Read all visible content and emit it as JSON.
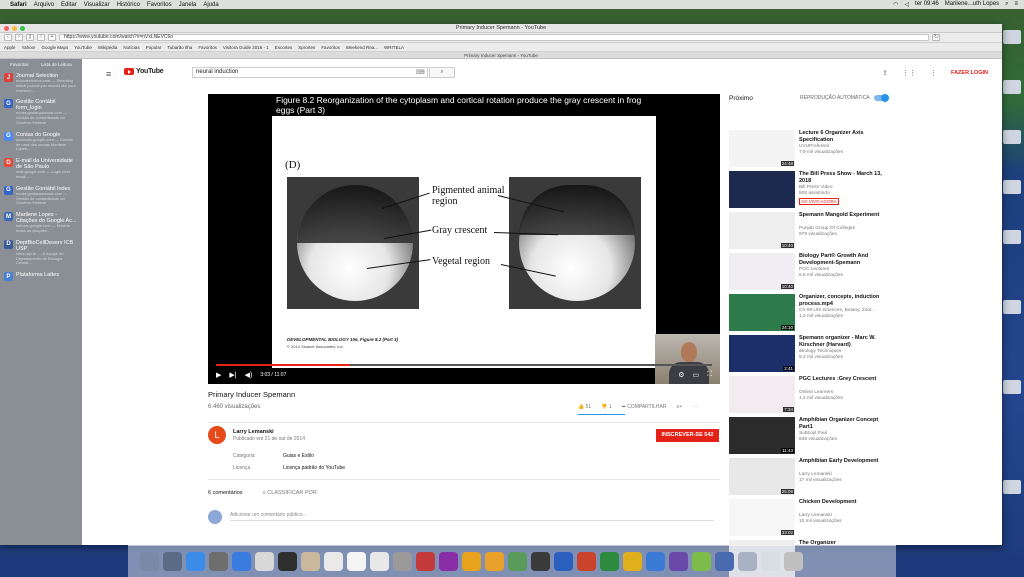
{
  "menubar": {
    "apple": "",
    "items": [
      "Safari",
      "Arquivo",
      "Editar",
      "Visualizar",
      "Histórico",
      "Favoritos",
      "Janela",
      "Ajuda"
    ],
    "clock": "ter 09:46",
    "user": "Marilene...uth Lopes"
  },
  "browser": {
    "window_title": "Primary Inducer Spemann - YouTube",
    "url": "https://www.youtube.com/watch?v=nVxLNEVC6o",
    "bookmarks": [
      "Apple",
      "Yahoo!",
      "Google Maps",
      "YouTube",
      "Wikipédia",
      "Notícias",
      "Popular",
      "Tubarão Ilha",
      "Favoritos",
      "Visitora Guide 2016 - 1",
      "Escortes",
      "Sprortes",
      "Favoritos",
      "Weekend Rea...",
      "WRITELA"
    ],
    "tab_title": "Primary Inducer Spemann - YouTube"
  },
  "sidebar": {
    "tab_bookmarks": "Favoritos",
    "tab_reading": "Lista de Leitura",
    "items": [
      {
        "title": "Journal Selection",
        "desc": "ecbiotechinfos.com — Selecting which journal you should like your research...",
        "color": "#d8423a",
        "glyph": "J"
      },
      {
        "title": "Gestão Contábil form_login",
        "desc": "ecoss.gestaopessoal.com — Gestão de contabilidade do Governo Federal",
        "color": "#3465c4",
        "glyph": "G"
      },
      {
        "title": "Contas do Google",
        "desc": "accounts.google.com — Contas de uma das contas Marilene Lopes...",
        "color": "#4a8af4",
        "glyph": "G"
      },
      {
        "title": "E-mail da Universidade de São Paulo",
        "desc": "mail.google.com — Login pelo email...",
        "color": "#e24a3a",
        "glyph": "G"
      },
      {
        "title": "Gestão Contábil Index",
        "desc": "ecoss.gestaopessoal.com — Gestão de contabilidade do Governo Federal",
        "color": "#3465c4",
        "glyph": "G"
      },
      {
        "title": "Marilene Lopes - Citações do Google Ac...",
        "desc": "scholar.google.com — Mostrar todas as citações...",
        "color": "#3c69b5",
        "glyph": "M"
      },
      {
        "title": "DeptBioCellDeserv ICB USP",
        "desc": "sites.usp.br — A equipe do Departamento de Biologia Celular...",
        "color": "#3b5b98",
        "glyph": "D"
      },
      {
        "title": "Plataforma Lattes",
        "desc": "",
        "color": "#4a7fd3",
        "glyph": "P"
      }
    ]
  },
  "youtube": {
    "logo_text": "YouTube",
    "search_value": "neural induction",
    "login": "FAZER LOGIN",
    "video": {
      "caption": "Figure 8.2  Reorganization of the cytoplasm and cortical rotation produce the gray crescent in frog eggs (Part 3)",
      "panel_label": "(D)",
      "labels": [
        "Pigmented animal region",
        "Gray crescent",
        "Vegetal region"
      ],
      "source": "DEVELOPMENTAL BIOLOGY 10e, Figure 8.2 (Part 3)",
      "copyright": "© 2014 Sinauer Associates, Inc.",
      "time": "3:03 / 11:07",
      "progress": 0.27
    },
    "title": "Primary Inducer Spemann",
    "views": "6.460 visualizações",
    "likes": "51",
    "dislikes": "1",
    "share": "COMPARTILHAR",
    "channel": "Larry Lemanski",
    "published": "Publicado em 21 de out de 2014",
    "subscribe": "INSCREVER-SE",
    "subscribers": "542",
    "category_label": "Categoria",
    "category": "Guias e Estilo",
    "license_label": "Licença",
    "license": "Licença padrão do YouTube",
    "comments_count": "6 comentários",
    "sort": "CLASSIFICAR POR",
    "comment_placeholder": "Adicionar um comentário público...",
    "upnext": "Próximo",
    "autoplay": "REPRODUÇÃO AUTOMÁTICA",
    "recommendations": [
      {
        "title": "Lecture 6 Organizer Axis Specification",
        "channel": "UVUProfessor",
        "views": "7,9 mil visualizações",
        "duration": "24:48",
        "thumb": "#f4f4f4",
        "live": ""
      },
      {
        "title": "The Bill Press Show - March 13, 2018",
        "channel": "Bill Press Video",
        "views": "508 assistindo",
        "duration": "",
        "thumb": "#1b2a4e",
        "live": "AO VIVO AGORA"
      },
      {
        "title": "Spemann Mangold Experiment",
        "channel": "Punjab Group Of Colleges",
        "views": "979 visualizações",
        "duration": "10:40",
        "thumb": "#eeeeee",
        "live": ""
      },
      {
        "title": "Biology Part® Growth And Development-Spemann",
        "channel": "PGC Lectures",
        "views": "6,6 mil visualizações",
        "duration": "10:40",
        "thumb": "#f0eef2",
        "live": ""
      },
      {
        "title": "Organizer, concepts, induction process.mp4",
        "channel": "Ch-09 Life Sciences, Botany, Zool...",
        "views": "1,2 mil visualizações",
        "duration": "24:10",
        "thumb": "#2d7a4a",
        "live": ""
      },
      {
        "title": "Spemann organizer - Marc W. Kirschner (Harvard)",
        "channel": "iBiology Techniques",
        "views": "9,2 mil visualizações",
        "duration": "2:41",
        "thumb": "#1d2f6a",
        "live": ""
      },
      {
        "title": "PGC Lectures :Grey Crescent",
        "channel": "Online Learners",
        "views": "1,2 mil visualizações",
        "duration": "7:34",
        "thumb": "#f2ecf0",
        "live": ""
      },
      {
        "title": "Amphibian Organizer Concept Part1",
        "channel": "Subbojit Paul",
        "views": "849 visualizações",
        "duration": "11:43",
        "thumb": "#2c2c2c",
        "live": ""
      },
      {
        "title": "Amphibian Early Development",
        "channel": "Larry Lemanski",
        "views": "17 mil visualizações",
        "duration": "25:09",
        "thumb": "#e8e8e8",
        "live": ""
      },
      {
        "title": "Chicken Development",
        "channel": "Larry Lemanski",
        "views": "10 mil visualizações",
        "duration": "33:02",
        "thumb": "#f6f6f6",
        "live": ""
      },
      {
        "title": "The Organizer",
        "channel": "",
        "views": "",
        "duration": "",
        "thumb": "#eeeeee",
        "live": ""
      }
    ]
  }
}
